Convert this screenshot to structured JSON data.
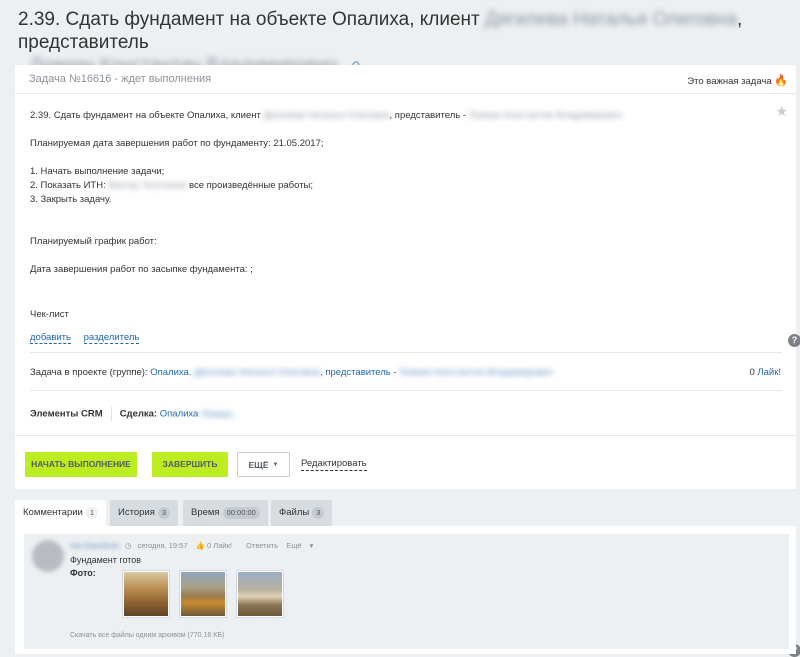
{
  "task": {
    "title_prefix": "2.39. Сдать фундамент на объекте Опалиха, клиент",
    "title_client": "Дягилева Наталья Олеговна",
    "title_middle": ", представитель",
    "title_dash": "-",
    "title_rep": "Ложкин Константин Владимирович",
    "status": "Задача №16616 - ждет выполнения",
    "important": "Это важная задача"
  },
  "description": {
    "line1_prefix": "2.39. Сдать фундамент на объекте Опалиха, клиент",
    "line1_client": "Дягилева Наталья Олеговна",
    "line1_middle": ", представитель -",
    "line1_rep": "Ложкин Константин Владимирович",
    "planned_date": "Планируемая дата завершения работ по фундаменту: 21.05.2017;",
    "step1": "1. Начать выполнение задачи;",
    "step2_prefix": "2. Показать ИТН:",
    "step2_name": "Виктор Толстиков",
    "step2_suffix": "все произведённые работы;",
    "step3": "3. Закрыть задачу.",
    "schedule": "Планируемый график работ:",
    "backfill": "Дата завершения работ по засыпке фундамента: ;"
  },
  "checklist": {
    "title": "Чек-лист",
    "add": "добавить",
    "separator": "разделитель"
  },
  "project": {
    "label": "Задача в проекте (группе):",
    "link_prefix": "Опалиха.",
    "link_client": "Дягилева Наталья Олеговна",
    "link_middle": ", представитель -",
    "link_rep": "Ложкин Константин Владимирович",
    "likes_count": "0",
    "likes_label": "Лайк!"
  },
  "crm": {
    "label": "Элементы CRM",
    "deal_label": "Сделка:",
    "deal_link": "Опалиха",
    "deal_hidden": "Ложкин"
  },
  "actions": {
    "start": "НАЧАТЬ ВЫПОЛНЕНИЕ",
    "finish": "ЗАВЕРШИТЬ",
    "more": "ЕЩЁ",
    "edit": "Редактировать"
  },
  "tabs": [
    {
      "label": "Комментарии",
      "count": "1"
    },
    {
      "label": "История",
      "count": "3"
    },
    {
      "label": "Время",
      "count": "00:00:00"
    },
    {
      "label": "Файлы",
      "count": "3"
    }
  ],
  "comment": {
    "author": "Ник Воробьёв",
    "time": "сегодня, 19:57",
    "likes": "0 Лайк!",
    "reply": "Ответить",
    "more": "Ещё",
    "text": "Фундамент готов",
    "photo_label": "Фото:",
    "archive": "Скачать все файлы одним архивом (770.16 КБ)"
  },
  "colors": {
    "accent_green": "#bbed21",
    "link_blue": "#2067b0",
    "page_bg": "#edf0f2"
  }
}
